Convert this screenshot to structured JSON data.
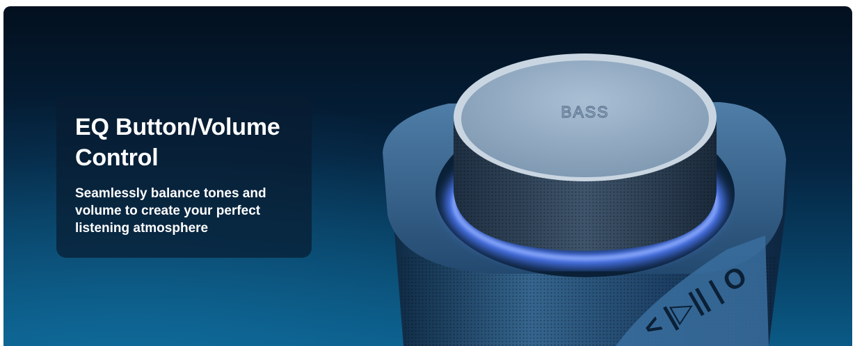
{
  "feature": {
    "title": "EQ Button/Volume Control",
    "description": "Seamlessly balance tones and volume to create your perfect listening atmosphere"
  },
  "product": {
    "knob_label": "BASS",
    "side_buttons": [
      "<",
      "|>||",
      "|",
      "O"
    ]
  },
  "colors": {
    "background_top": "#03101f",
    "background_bottom": "#0a5a86",
    "card_bg": "#081c30",
    "accent_glow": "#5b8cff",
    "text": "#ffffff"
  }
}
